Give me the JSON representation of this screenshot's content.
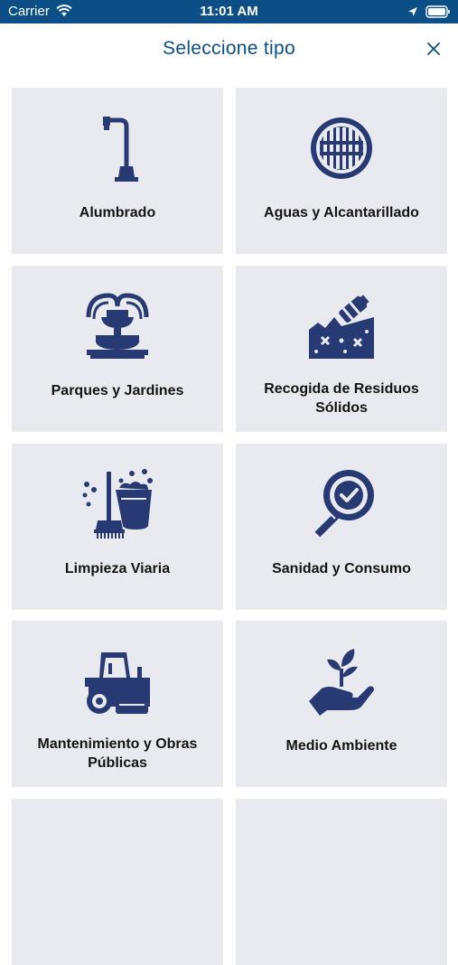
{
  "status_bar": {
    "carrier": "Carrier",
    "time": "11:01 AM"
  },
  "header": {
    "title": "Seleccione tipo",
    "close_icon": "close-icon"
  },
  "colors": {
    "status_bar_bg": "#0b4f86",
    "title": "#0b4f86",
    "icon": "#273a73",
    "tile_bg": "#e9eaef"
  },
  "categories": [
    {
      "label": "Alumbrado",
      "icon": "street-lamp-icon"
    },
    {
      "label": "Aguas y Alcantarillado",
      "icon": "drain-grate-icon"
    },
    {
      "label": "Parques y Jardines",
      "icon": "fountain-icon"
    },
    {
      "label": "Recogida de Residuos Sólidos",
      "icon": "waste-bag-icon"
    },
    {
      "label": "Limpieza Viaria",
      "icon": "broom-bucket-icon"
    },
    {
      "label": "Sanidad y Consumo",
      "icon": "magnifier-check-icon"
    },
    {
      "label": "Mantenimiento y Obras Públicas",
      "icon": "road-roller-icon"
    },
    {
      "label": "Medio Ambiente",
      "icon": "hand-plant-icon"
    }
  ]
}
